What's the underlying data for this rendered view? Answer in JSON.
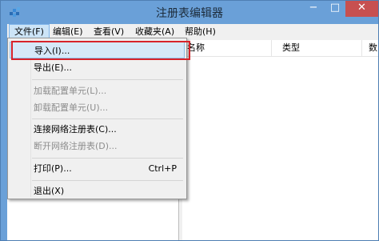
{
  "window": {
    "title": "注册表编辑器",
    "minimize_glyph": "−",
    "maximize_glyph": "□",
    "close_glyph": "✕",
    "accent": "#6aa0d8",
    "close_color": "#c75050"
  },
  "menubar": {
    "file": "文件(F)",
    "edit": "编辑(E)",
    "view": "查看(V)",
    "favorites": "收藏夹(A)",
    "help": "帮助(H)"
  },
  "list": {
    "col_name": "名称",
    "col_type": "类型",
    "col_data": "数"
  },
  "file_menu": {
    "import": "导入(I)...",
    "export": "导出(E)...",
    "load_hive": "加载配置单元(L)...",
    "unload_hive": "卸载配置单元(U)...",
    "connect": "连接网络注册表(C)...",
    "disconnect": "断开网络注册表(D)...",
    "print": "打印(P)...",
    "print_shortcut": "Ctrl+P",
    "exit": "退出(X)"
  },
  "highlight_color": "#d8232a"
}
